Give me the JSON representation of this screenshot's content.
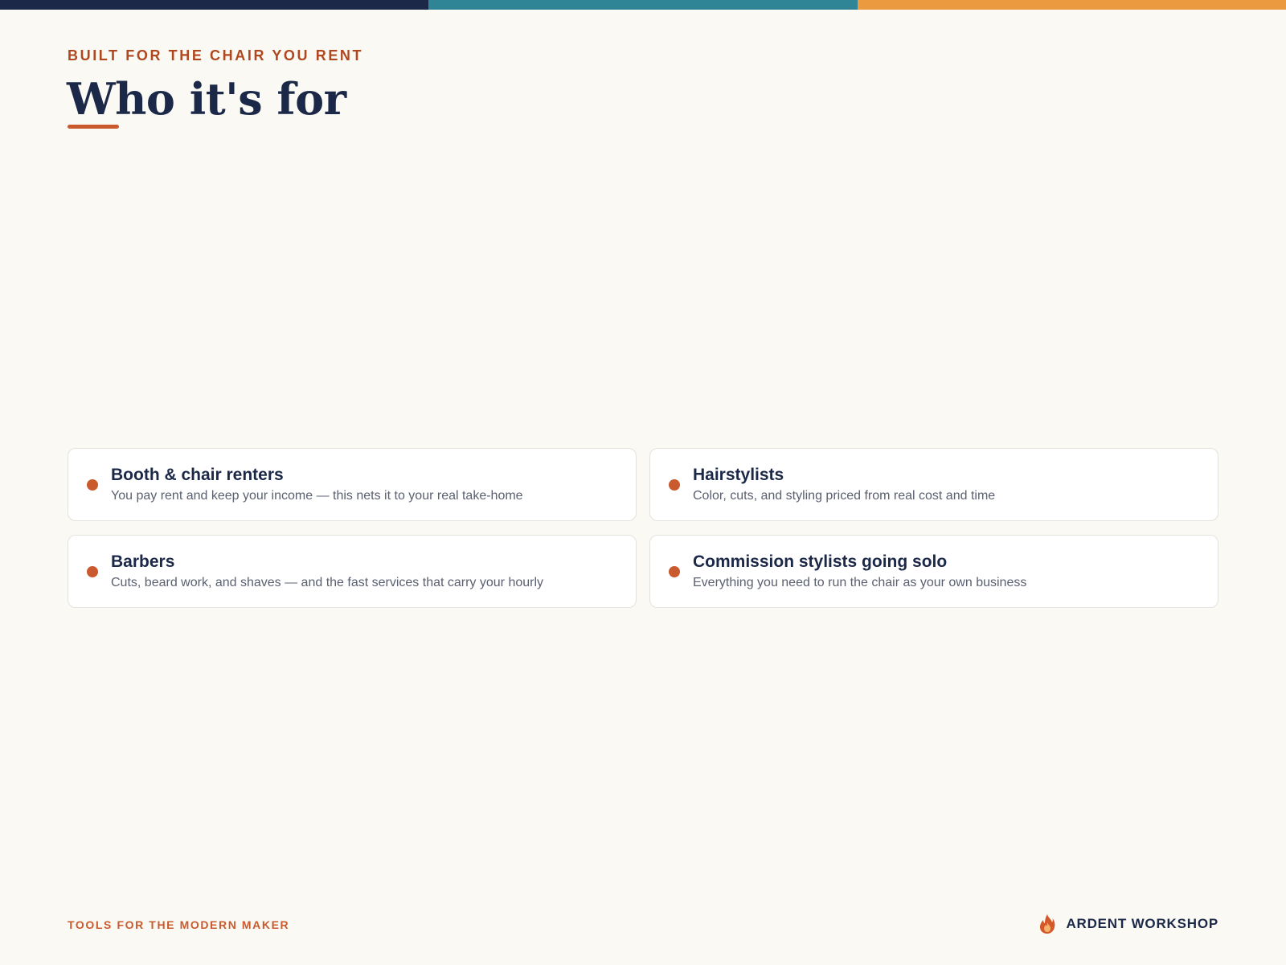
{
  "header": {
    "eyebrow": "BUILT FOR THE CHAIR YOU RENT",
    "title": "Who it's for"
  },
  "colors": {
    "navy": "#1c2847",
    "teal": "#2f8496",
    "orange": "#eb9a3f",
    "accent": "#c95a2e",
    "background": "#faf9f4"
  },
  "cards": [
    {
      "title": "Booth & chair renters",
      "description": "You pay rent and keep your income — this nets it to your real take-home"
    },
    {
      "title": "Hairstylists",
      "description": "Color, cuts, and styling priced from real cost and time"
    },
    {
      "title": "Barbers",
      "description": "Cuts, beard work, and shaves — and the fast services that carry your hourly"
    },
    {
      "title": "Commission stylists going solo",
      "description": "Everything you need to run the chair as your own business"
    }
  ],
  "footer": {
    "tagline": "TOOLS FOR THE MODERN MAKER",
    "brand_icon": "flame-icon",
    "brand_name": "ARDENT WORKSHOP"
  }
}
